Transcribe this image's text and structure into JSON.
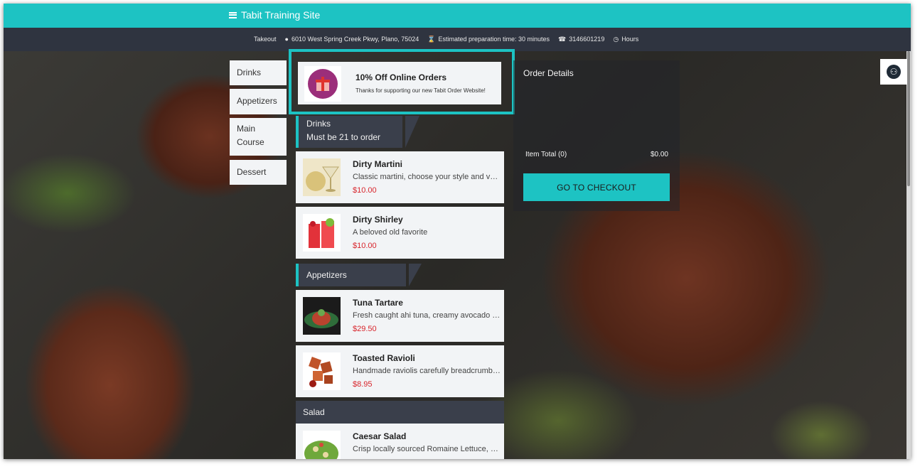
{
  "topbar": {
    "title": "Tabit Training Site",
    "color": "#1dc3c3"
  },
  "infobar": {
    "mode": "Takeout",
    "address": "6010 West Spring Creek Pkwy, Plano, 75024",
    "prep_time": "Estimated preparation time: 30 minutes",
    "phone": "3146601219",
    "hours": "Hours"
  },
  "categories": [
    "Drinks",
    "Appetizers",
    "Main Course",
    "Dessert"
  ],
  "promo": {
    "title": "10% Off Online Orders",
    "subtitle": "Thanks for supporting our new Tabit Order Website!"
  },
  "sections": {
    "drinks": {
      "title": "Drinks",
      "subtitle": "Must be 21 to order"
    },
    "appetizers": {
      "title": "Appetizers"
    },
    "salad": {
      "title": "Salad"
    }
  },
  "items": [
    {
      "name": "Dirty Martini",
      "desc": "Classic martini, choose your style and vodka",
      "price": "$10.00"
    },
    {
      "name": "Dirty Shirley",
      "desc": "A beloved old favorite",
      "price": "$10.00"
    },
    {
      "name": "Tuna Tartare",
      "desc": "Fresh caught ahi tuna, creamy avocado and more",
      "price": "$29.50"
    },
    {
      "name": "Toasted Ravioli",
      "desc": "Handmade raviolis carefully breadcrumbed",
      "price": "$8.95"
    },
    {
      "name": "Caesar Salad",
      "desc": "Crisp locally sourced Romaine Lettuce, croutons",
      "price": ""
    }
  ],
  "order": {
    "title": "Order Details",
    "total_label": "Item Total (0)",
    "total_value": "$0.00",
    "checkout_label": "GO TO CHECKOUT"
  },
  "colors": {
    "accent": "#1dc3c3",
    "price": "#d8242b",
    "dark": "#2f3440"
  }
}
